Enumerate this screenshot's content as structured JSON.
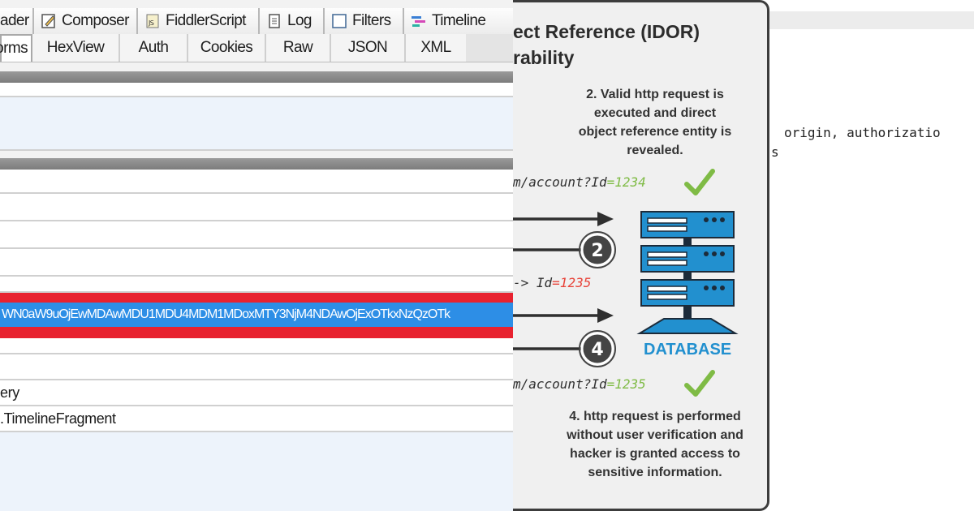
{
  "fiddler": {
    "top_tabs": [
      {
        "label": "ader",
        "icon": "none"
      },
      {
        "label": "Composer",
        "icon": "composer-icon"
      },
      {
        "label": "FiddlerScript",
        "icon": "script-icon"
      },
      {
        "label": "Log",
        "icon": "log-icon"
      },
      {
        "label": "Filters",
        "icon": "checkbox-icon"
      },
      {
        "label": "Timeline",
        "icon": "timeline-icon"
      }
    ],
    "sub_tabs": [
      {
        "label": "orms"
      },
      {
        "label": "HexView"
      },
      {
        "label": "Auth"
      },
      {
        "label": "Cookies"
      },
      {
        "label": "Raw"
      },
      {
        "label": "JSON"
      },
      {
        "label": "XML"
      }
    ],
    "highlighted_token": "WN0aW9uOjEwMDAwMDU1MDU4MDM1MDoxMTY3NjM4NDAwOjExOTkxNzQzOTk",
    "row_query": "ery",
    "row_fragment": ".TimelineFragment"
  },
  "idor": {
    "title_line1": "ect Reference (IDOR)",
    "title_line2": "rability",
    "step2": [
      "2. Valid http request is",
      "executed and direct",
      "object reference entity is",
      "revealed."
    ],
    "url1_prefix": "m/account?Id",
    "url1_value": "=1234",
    "tamper_prefix": "-> Id",
    "tamper_value": "=1235",
    "badge2": "2",
    "badge4": "4",
    "db_label": "DATABASE",
    "url2_prefix": "m/account?Id",
    "url2_value": "=1235",
    "step4": [
      "4. http request is performed",
      "without user verification and",
      "hacker is granted access to",
      "sensitive information."
    ],
    "colors": {
      "check": "#7fbb45",
      "tamper": "#e8443a",
      "database": "#2290cf"
    }
  },
  "code_panel": {
    "line1": "",
    "line2": "origin, authorizatio",
    "line3": "s"
  }
}
